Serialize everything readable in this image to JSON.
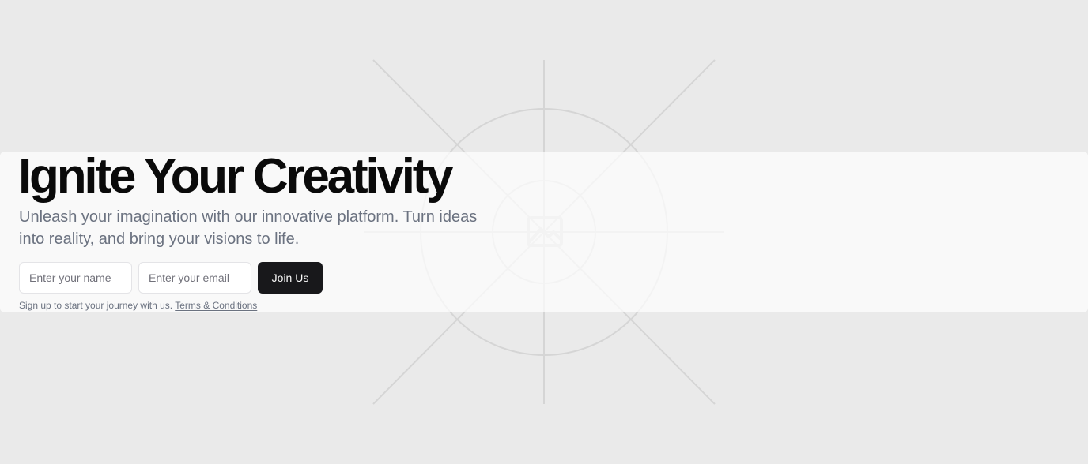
{
  "hero": {
    "title": "Ignite Your Creativity",
    "subtitle": "Unleash your imagination with our innovative platform. Turn ideas into reality, and bring your visions to life."
  },
  "form": {
    "name_placeholder": "Enter your name",
    "email_placeholder": "Enter your email",
    "submit_label": "Join Us"
  },
  "footer_note": {
    "text": "Sign up to start your journey with us.",
    "link_label": "Terms & Conditions"
  },
  "background": {
    "icon": "image-placeholder-icon"
  },
  "colors": {
    "page_background": "#eaeaea",
    "title": "#0a0a0a",
    "muted_text": "#6b7280",
    "button_background": "#18181b",
    "button_text": "#fafafa"
  }
}
